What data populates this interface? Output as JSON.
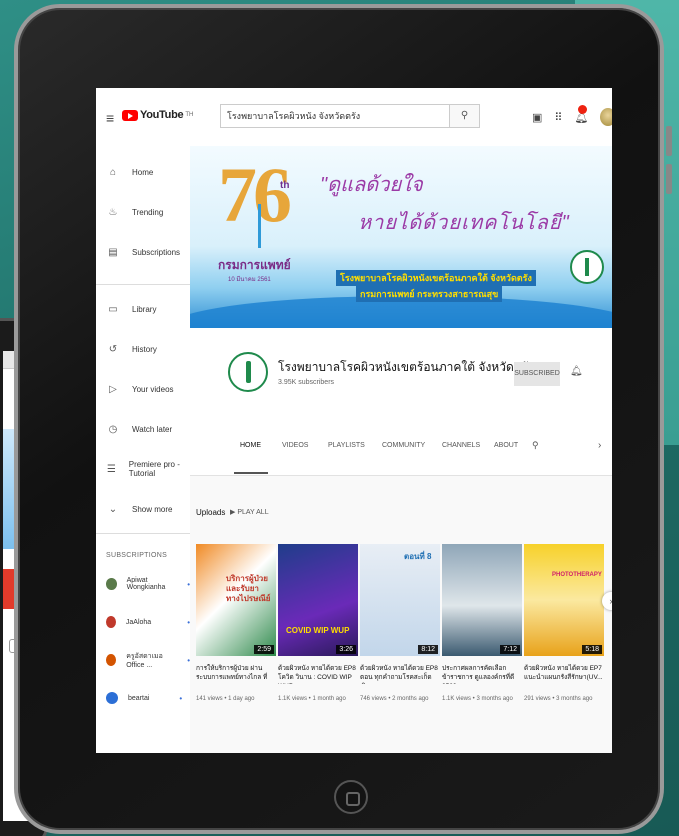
{
  "topbar": {
    "logo_text": "YouTube",
    "logo_region": "TH",
    "search_value": "โรงพยาบาลโรคผิวหนัง จังหวัดตรัง",
    "search_placeholder": "Search"
  },
  "sidebar": {
    "main_items": [
      {
        "label": "Home",
        "icon": "home-icon"
      },
      {
        "label": "Trending",
        "icon": "trending-icon"
      },
      {
        "label": "Subscriptions",
        "icon": "subscriptions-icon"
      }
    ],
    "library_items": [
      {
        "label": "Library",
        "icon": "library-icon"
      },
      {
        "label": "History",
        "icon": "history-icon"
      },
      {
        "label": "Your videos",
        "icon": "your-videos-icon"
      },
      {
        "label": "Watch later",
        "icon": "watch-later-icon"
      },
      {
        "label": "Premiere pro - Tutorial",
        "icon": "playlist-icon"
      },
      {
        "label": "Show more",
        "icon": "chevron-down-icon"
      }
    ],
    "subscriptions_heading": "SUBSCRIPTIONS",
    "subscriptions": [
      {
        "label": "Apiwat Wongkianha",
        "color": "#5a7a4a"
      },
      {
        "label": "JaAloha",
        "color": "#c0392b"
      },
      {
        "label": "ครูอัสดาเมอ Office ...",
        "color": "#d35400"
      },
      {
        "label": "beartai",
        "color": "#2c6fd6"
      }
    ]
  },
  "banner": {
    "anniversary_number": "76",
    "anniversary_suffix": "th",
    "department": "กรมการแพทย์",
    "date": "10 มีนาคม 2561",
    "quote_line1": "\"ดูแลด้วยใจ",
    "quote_line2": "หายได้ด้วยเทคโนโลยี\"",
    "org_line1": "โรงพยาบาลโรคผิวหนังเขตร้อนภาคใต้ จังหวัดตรัง",
    "org_line2": "กรมการแพทย์ กระทรวงสาธารณสุข"
  },
  "channel": {
    "name": "โรงพยาบาลโรคผิวหนังเขตร้อนภาคใต้ จังหวัดตรัง",
    "subscribers": "3.95K subscribers",
    "subscribed_label": "SUBSCRIBED"
  },
  "tabs": [
    "HOME",
    "VIDEOS",
    "PLAYLISTS",
    "COMMUNITY",
    "CHANNELS",
    "ABOUT"
  ],
  "uploads": {
    "title": "Uploads",
    "play_all": "PLAY ALL"
  },
  "videos": [
    {
      "duration": "2:59",
      "title": "การให้บริการผู้ป่วย ผ่านระบบการแพทย์ทางไกล ที่รพ.ทาง...",
      "meta": "141 views • 1 day ago",
      "thumb_text": "บริการผู้ป่วย และรับยาทางไปรษณีย์",
      "color_a": "#f08a24",
      "color_b": "#2f8a4c"
    },
    {
      "duration": "3:26",
      "title": "ด้วยผิวหนัง หายได้ดวย EP8 โควิด วินาน : COVID WIP WUP",
      "meta": "1.1K views • 1 month ago",
      "thumb_text": "COVID WIP WUP",
      "color_a": "#1f3d8a",
      "color_b": "#6a2ab8"
    },
    {
      "duration": "8:12",
      "title": "ด้วยผิวหนัง หายได้ดวย EP8 ตอน ทุกคำถามโรคสะเก็ดเงิน...",
      "meta": "746 views • 2 months ago",
      "thumb_text": "ตอนที่ 8",
      "color_a": "#e8eef5",
      "color_b": "#c2d6ea"
    },
    {
      "duration": "7:12",
      "title": "ประกาศผลการคัดเลือกข้าราชการ ดูแลองค์กรที่ดี 2563",
      "meta": "1.1K views • 3 months ago",
      "thumb_text": "",
      "color_a": "#8fa6b8",
      "color_b": "#3b5a70"
    },
    {
      "duration": "5:18",
      "title": "ด้วยผิวหนัง หายได้ดวย EP7 แนะนำแผนกรังสีรักษา(UV...",
      "meta": "291 views • 3 months ago",
      "thumb_text": "PHOTOTHERAPY",
      "color_a": "#f7d12a",
      "color_b": "#e8a21a"
    }
  ],
  "colors": {
    "youtube_red": "#ff0000",
    "banner_purple": "#9b3aa6",
    "banner_gold": "#e7a63a",
    "hospital_green": "#1f8a4c"
  }
}
